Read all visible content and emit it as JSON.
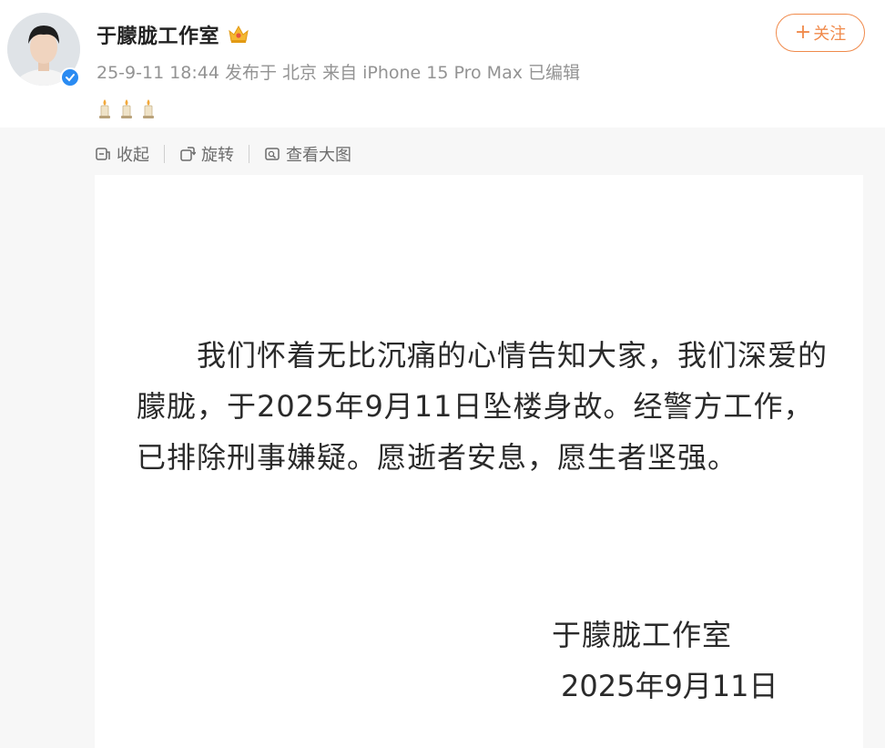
{
  "post": {
    "username": "于朦胧工作室",
    "meta": "25-9-11 18:44 发布于 北京 来自 iPhone 15 Pro Max 已编辑",
    "follow_label": "关注",
    "follow_plus": "+",
    "candle_count": 3
  },
  "toolbar": {
    "collapse_label": "收起",
    "rotate_label": "旋转",
    "view_large_label": "查看大图"
  },
  "notice": {
    "body": "我们怀着无比沉痛的心情告知大家，我们深爱的朦胧，于2025年9月11日坠楼身故。经警方工作，已排除刑事嫌疑。愿逝者安息，愿生者坚强。",
    "signature": "于朦胧工作室",
    "date": "2025年9月11日"
  },
  "colors": {
    "accent": "#f08a4b",
    "verify": "#2a8bf2",
    "meta_text": "#939393",
    "content_bg": "#f7f7f7"
  }
}
